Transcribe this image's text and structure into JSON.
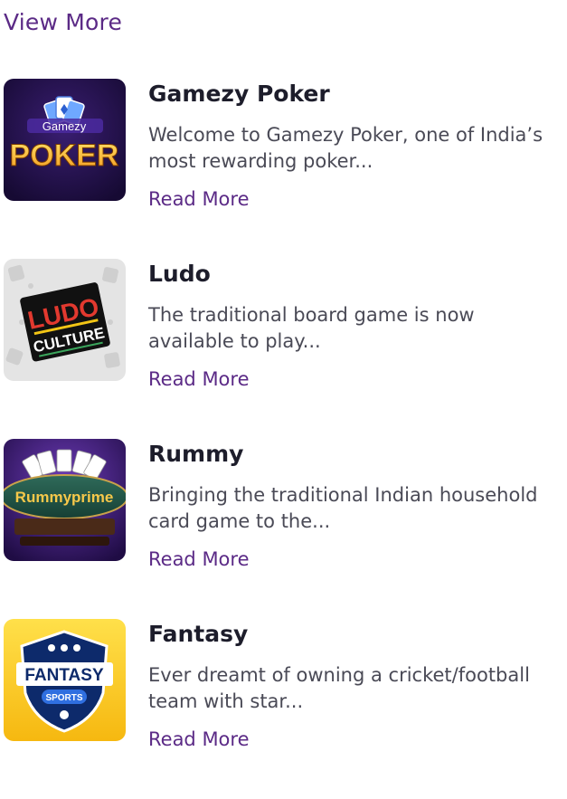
{
  "view_more_label": "View More",
  "games": [
    {
      "title": "Gamezy Poker",
      "description": "Welcome to Gamezy Poker, one of India’s most rewarding poker...",
      "read_more": "Read More",
      "thumb_text": [
        "Gamezy",
        "POKER"
      ]
    },
    {
      "title": "Ludo",
      "description": "The traditional board game is now available to play...",
      "read_more": "Read More",
      "thumb_text": [
        "LUDO",
        "CULTURE"
      ]
    },
    {
      "title": "Rummy",
      "description": "Bringing the traditional Indian household card game to the...",
      "read_more": "Read More",
      "thumb_text": [
        "Rummyprime"
      ]
    },
    {
      "title": "Fantasy",
      "description": "Ever dreamt of owning a cricket/football team with star...",
      "read_more": "Read More",
      "thumb_text": [
        "FANTASY",
        "SPORTS"
      ]
    }
  ],
  "colors": {
    "link": "#5b2a86",
    "title": "#1d1d2b",
    "body_text": "#4a4a56"
  }
}
